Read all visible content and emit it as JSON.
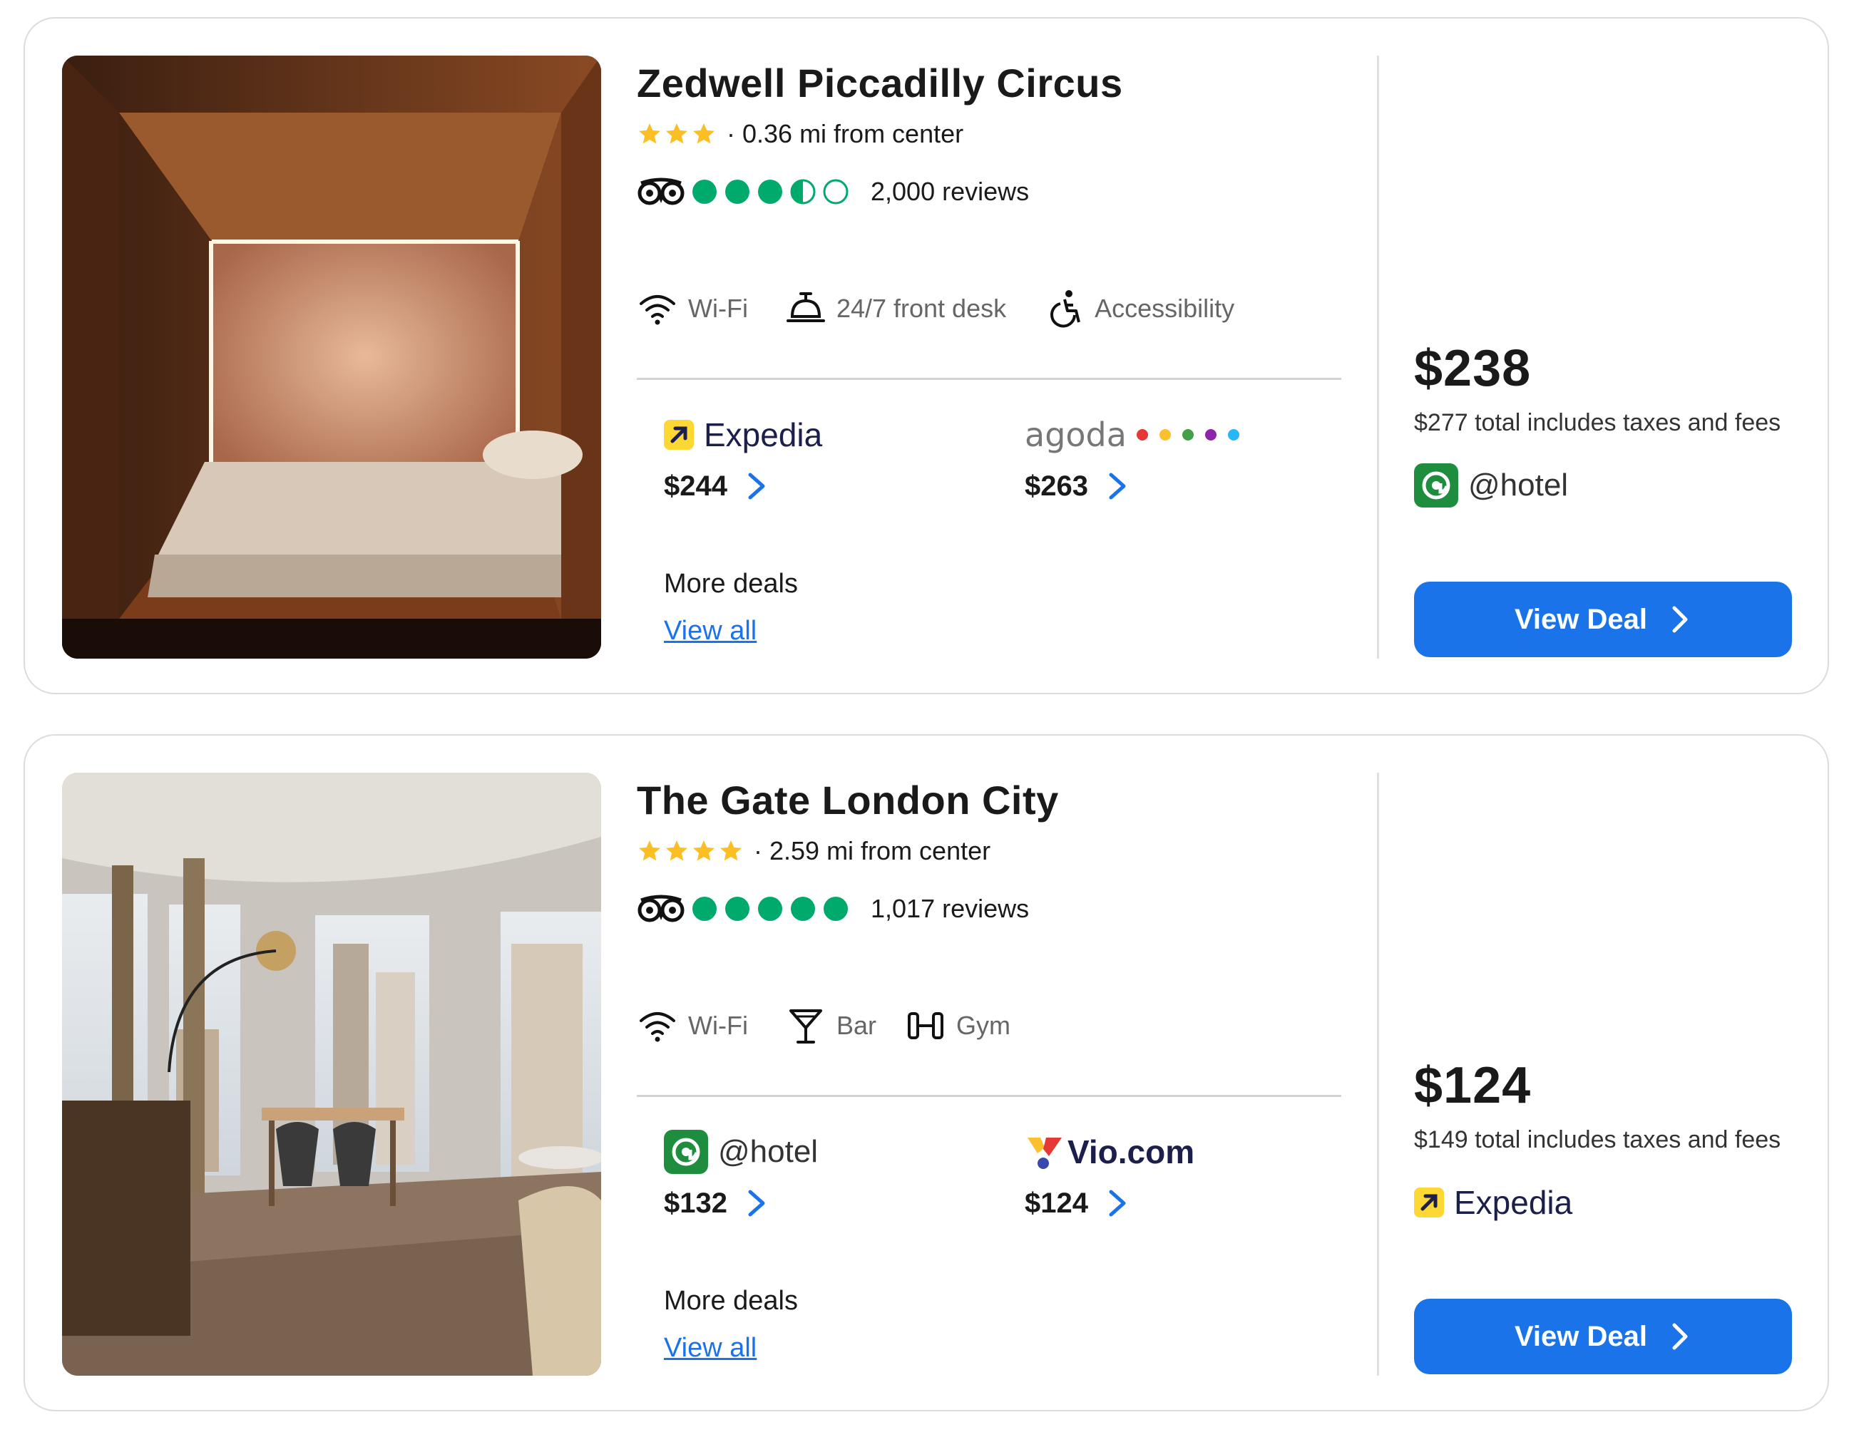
{
  "colors": {
    "accent": "#1a73e8",
    "tripadvisor_green": "#00aa6c",
    "star_yellow": "#fbbf24",
    "hotel_green": "#1e8e3e",
    "expedia_yellow": "#fdd835"
  },
  "hotels": [
    {
      "name": "Zedwell Piccadilly Circus",
      "stars": 3,
      "distance": "0.36 mi from center",
      "bubble_rating": 3.5,
      "reviews": "2,000 reviews",
      "amenities": [
        {
          "icon": "wifi-icon",
          "label": "Wi-Fi"
        },
        {
          "icon": "front-desk-bell-icon",
          "label": "24/7 front desk"
        },
        {
          "icon": "accessibility-icon",
          "label": "Accessibility"
        }
      ],
      "deals": [
        {
          "provider": "Expedia",
          "price": "$244"
        },
        {
          "provider": "agoda",
          "price": "$263"
        }
      ],
      "more_deals": "More deals",
      "view_all": "View all",
      "best_price": "$238",
      "total_text": "$277 total includes taxes and fees",
      "best_provider": "@hotel",
      "cta": "View Deal"
    },
    {
      "name": "The Gate London City",
      "stars": 4,
      "distance": "2.59 mi from center",
      "bubble_rating": 5,
      "reviews": "1,017 reviews",
      "amenities": [
        {
          "icon": "wifi-icon",
          "label": "Wi-Fi"
        },
        {
          "icon": "cocktail-glass-icon",
          "label": "Bar"
        },
        {
          "icon": "dumbbell-icon",
          "label": "Gym"
        }
      ],
      "deals": [
        {
          "provider": "@hotel",
          "price": "$132"
        },
        {
          "provider": "Vio.com",
          "price": "$124"
        }
      ],
      "more_deals": "More deals",
      "view_all": "View all",
      "best_price": "$124",
      "total_text": "$149 total includes taxes and fees",
      "best_provider": "Expedia",
      "cta": "View Deal"
    }
  ]
}
